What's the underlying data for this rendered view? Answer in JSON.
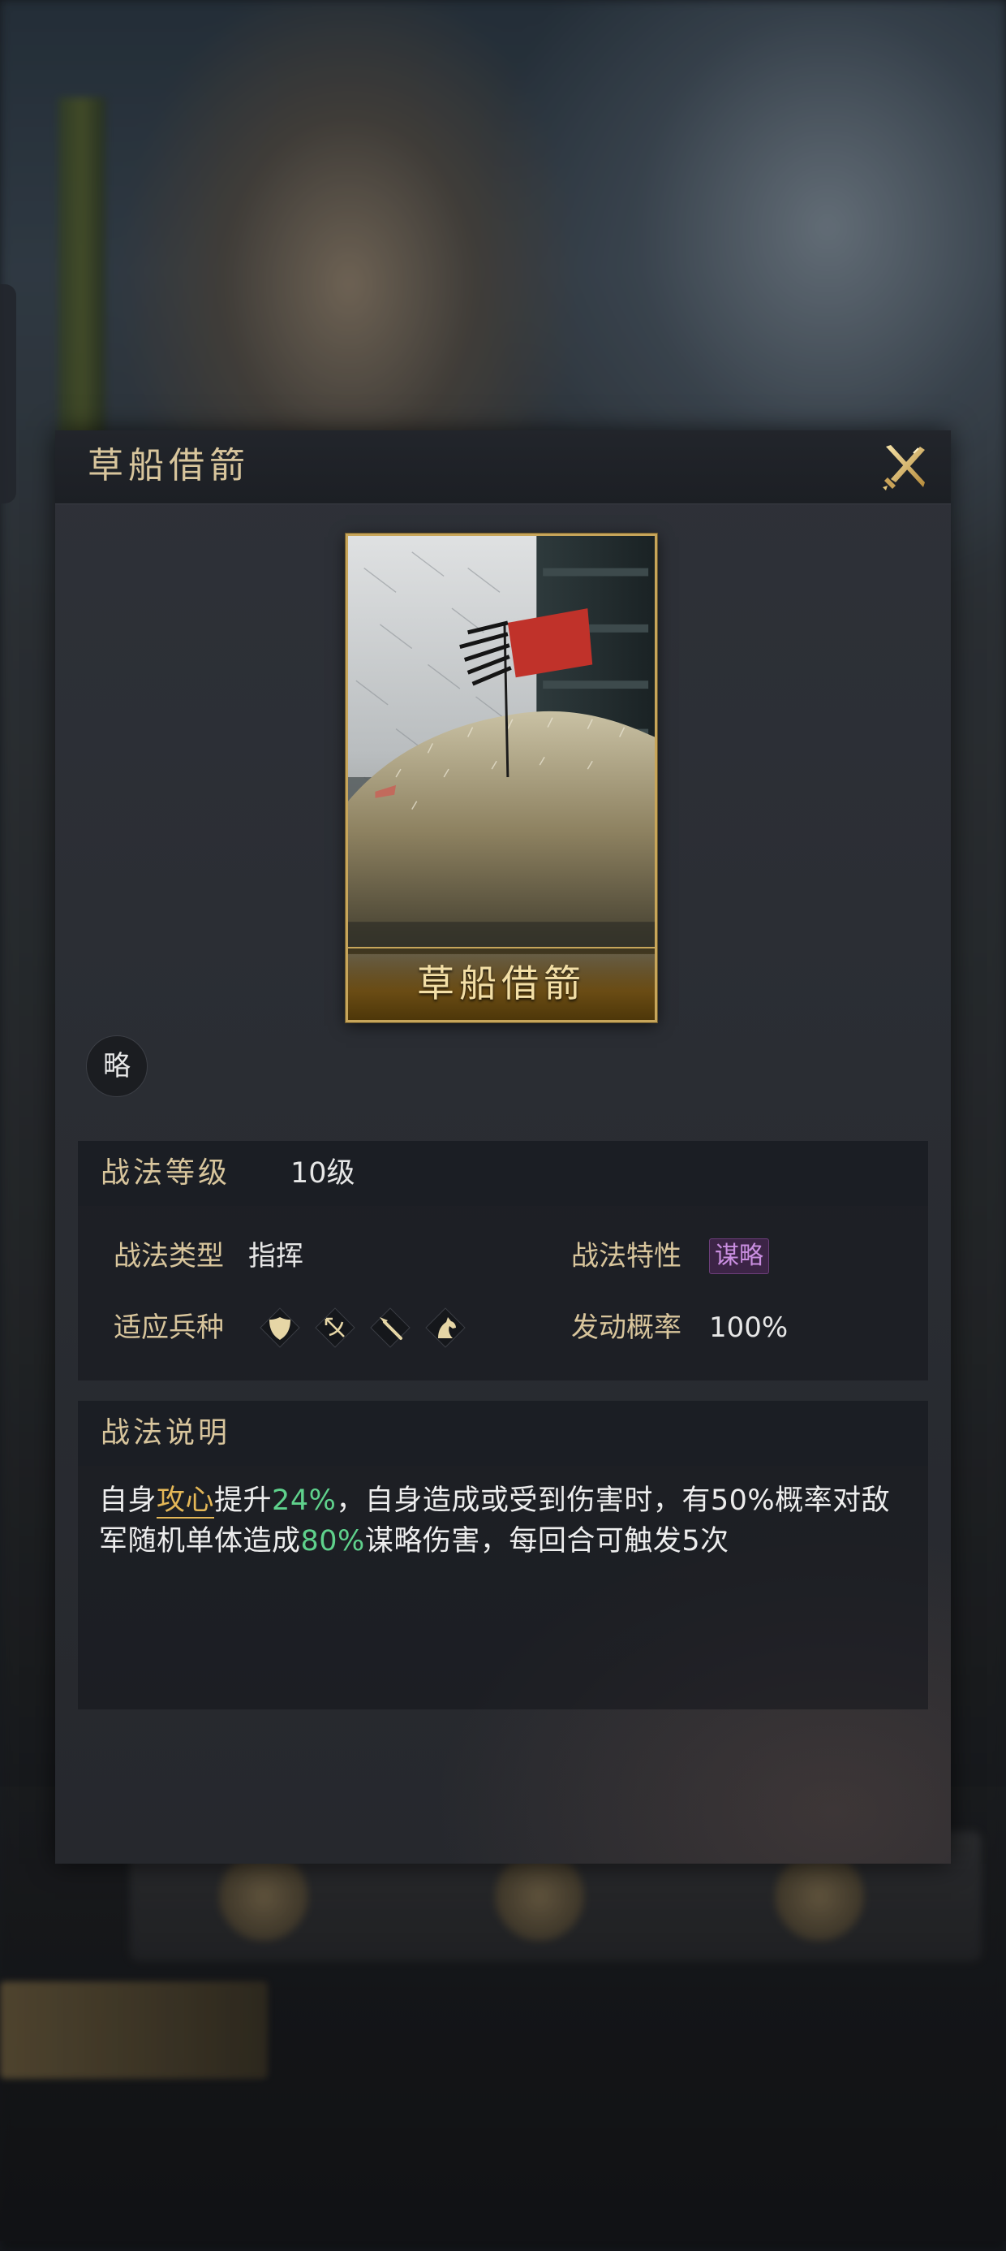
{
  "dialog": {
    "title": "草船借箭",
    "close_icon": "crossed-swords-close-icon"
  },
  "skill_card": {
    "name": "草船借箭",
    "art": "boats-with-straw-and-red-flag-in-arrow-rain"
  },
  "type_badge": "略",
  "info": {
    "level_label": "战法等级",
    "level_value": "10级",
    "type_label": "战法类型",
    "type_value": "指挥",
    "trait_label": "战法特性",
    "trait_value": "谋略",
    "troops_label": "适应兵种",
    "troop_icons": [
      "shield-icon",
      "crossbow-icon",
      "spear-icon",
      "horse-icon"
    ],
    "rate_label": "发动概率",
    "rate_value": "100%"
  },
  "description": {
    "title": "战法说明",
    "seg1": "自身",
    "seg2_hl": "攻心",
    "seg3": "提升",
    "seg4_num": "24%",
    "seg5": "，自身造成或受到伤害时，有50%概率对敌军随机单体造成",
    "seg6_num": "80%",
    "seg7": "谋略伤害，每回合可触发5次"
  },
  "colors": {
    "gold_text": "#d8c59c",
    "highlight_gold": "#e4b757",
    "highlight_green": "#5fd18c",
    "trait_purple": "#c98ee0"
  }
}
